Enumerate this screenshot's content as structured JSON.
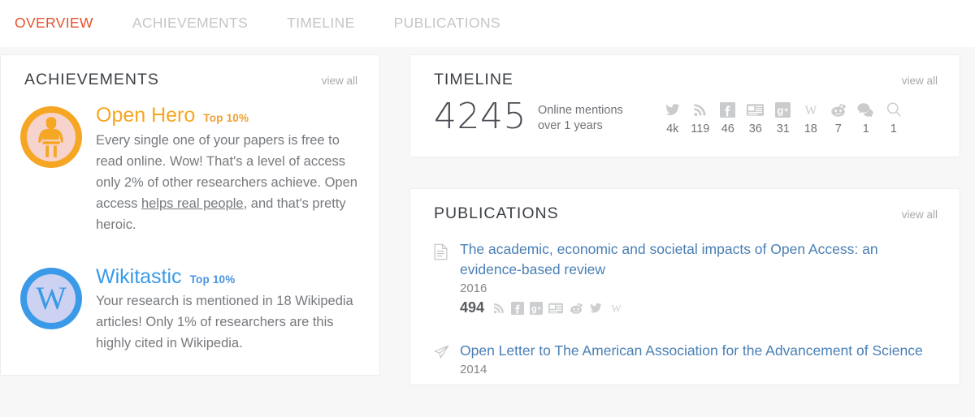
{
  "nav": {
    "tabs": [
      {
        "label": "OVERVIEW",
        "active": true
      },
      {
        "label": "ACHIEVEMENTS",
        "active": false
      },
      {
        "label": "TIMELINE",
        "active": false
      },
      {
        "label": "PUBLICATIONS",
        "active": false
      }
    ],
    "active_color": "#e8502a",
    "inactive_color": "#c3c5c7"
  },
  "achievements": {
    "title": "ACHIEVEMENTS",
    "view_all": "view all",
    "items": [
      {
        "badge_icon": "superhero-icon",
        "title": "Open Hero",
        "rank": "Top 10%",
        "color": "#f5a623",
        "desc_before": "Every single one of your papers is free to read online. Wow! That's a level of access only 2% of other researchers achieve. Open access ",
        "desc_link": "helps real people",
        "desc_after": ", and that's pretty heroic."
      },
      {
        "badge_icon": "wikipedia-icon",
        "title": "Wikitastic",
        "rank": "Top 10%",
        "color": "#3b9ae8",
        "desc_before": "Your research is mentioned in 18 Wikipedia articles! Only 1% of researchers are this highly cited in Wikipedia.",
        "desc_link": "",
        "desc_after": ""
      }
    ]
  },
  "timeline": {
    "title": "TIMELINE",
    "view_all": "view all",
    "total": "4245",
    "label_line1": "Online mentions",
    "label_line2": "over 1 years",
    "stats": [
      {
        "icon": "twitter-icon",
        "count": "4k"
      },
      {
        "icon": "rss-icon",
        "count": "119"
      },
      {
        "icon": "facebook-icon",
        "count": "46"
      },
      {
        "icon": "news-icon",
        "count": "36"
      },
      {
        "icon": "googleplus-icon",
        "count": "31"
      },
      {
        "icon": "wikipedia-icon",
        "count": "18"
      },
      {
        "icon": "reddit-icon",
        "count": "7"
      },
      {
        "icon": "comment-icon",
        "count": "1"
      },
      {
        "icon": "search-icon",
        "count": "1"
      }
    ]
  },
  "publications": {
    "title": "PUBLICATIONS",
    "view_all": "view all",
    "items": [
      {
        "icon": "document-icon",
        "title": "The academic, economic and societal impacts of Open Access: an evidence-based review",
        "year": "2016",
        "count": "494",
        "metric_icons": [
          "rss-icon",
          "facebook-icon",
          "googleplus-icon",
          "news-icon",
          "reddit-icon",
          "twitter-icon",
          "wikipedia-icon"
        ]
      },
      {
        "icon": "paper-plane-icon",
        "title": "Open Letter to The American Association for the Advancement of Science",
        "year": "2014",
        "count": "",
        "metric_icons": []
      }
    ]
  }
}
